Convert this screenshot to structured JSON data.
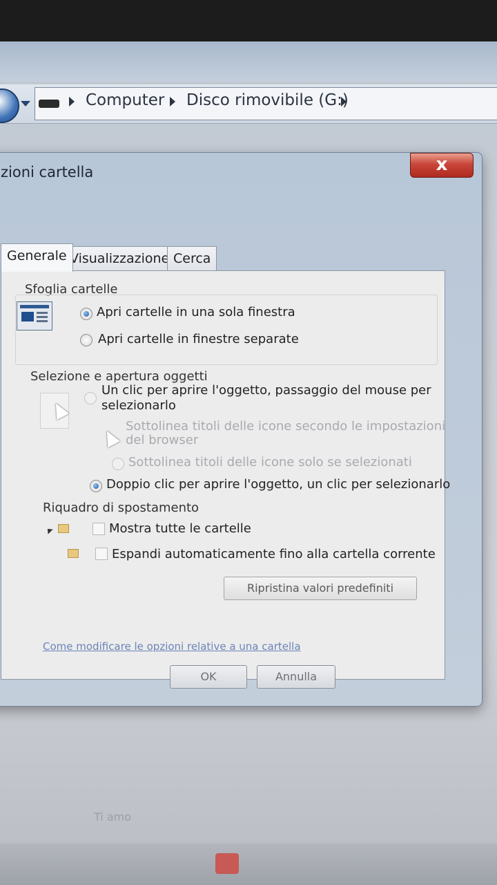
{
  "explorer": {
    "breadcrumb": [
      "Computer",
      "Disco rimovibile (G:)"
    ]
  },
  "dialog": {
    "title": "zioni cartella",
    "close_label": "x",
    "tabs": [
      "Generale",
      "Visualizzazione",
      "Cerca"
    ],
    "active_tab": "Generale",
    "browse_group": {
      "label": "Sfoglia cartelle",
      "options": [
        {
          "label": "Apri cartelle in una sola finestra",
          "selected": true
        },
        {
          "label": "Apri cartelle in finestre separate",
          "selected": false
        }
      ]
    },
    "click_group": {
      "label": "Selezione e apertura oggetti",
      "single_click_line1": "Un clic per aprire l'oggetto, passaggio del mouse per",
      "single_click_line2": "selezionarlo",
      "underline_browser_line1": "Sottolinea titoli delle icone secondo le impostazioni",
      "underline_browser_line2": "del browser",
      "underline_hover": "Sottolinea titoli delle icone solo se selezionati",
      "double_click": "Doppio clic per aprire l'oggetto, un clic per selezionarlo",
      "double_click_selected": true
    },
    "nav_group": {
      "label": "Riquadro di spostamento",
      "show_all": "Mostra tutte le cartelle",
      "auto_expand": "Espandi automaticamente fino alla cartella corrente"
    },
    "restore_button": "Ripristina valori predefiniti",
    "help_link": "Come modificare le opzioni relative a una cartella",
    "ok_button": "OK",
    "cancel_button": "Annulla"
  },
  "taskbar": {
    "faded_label": "Ti amo"
  },
  "colors": {
    "close_red": "#c9463a",
    "radio_blue": "#1c5aa6",
    "link_blue": "#6a84b8"
  }
}
